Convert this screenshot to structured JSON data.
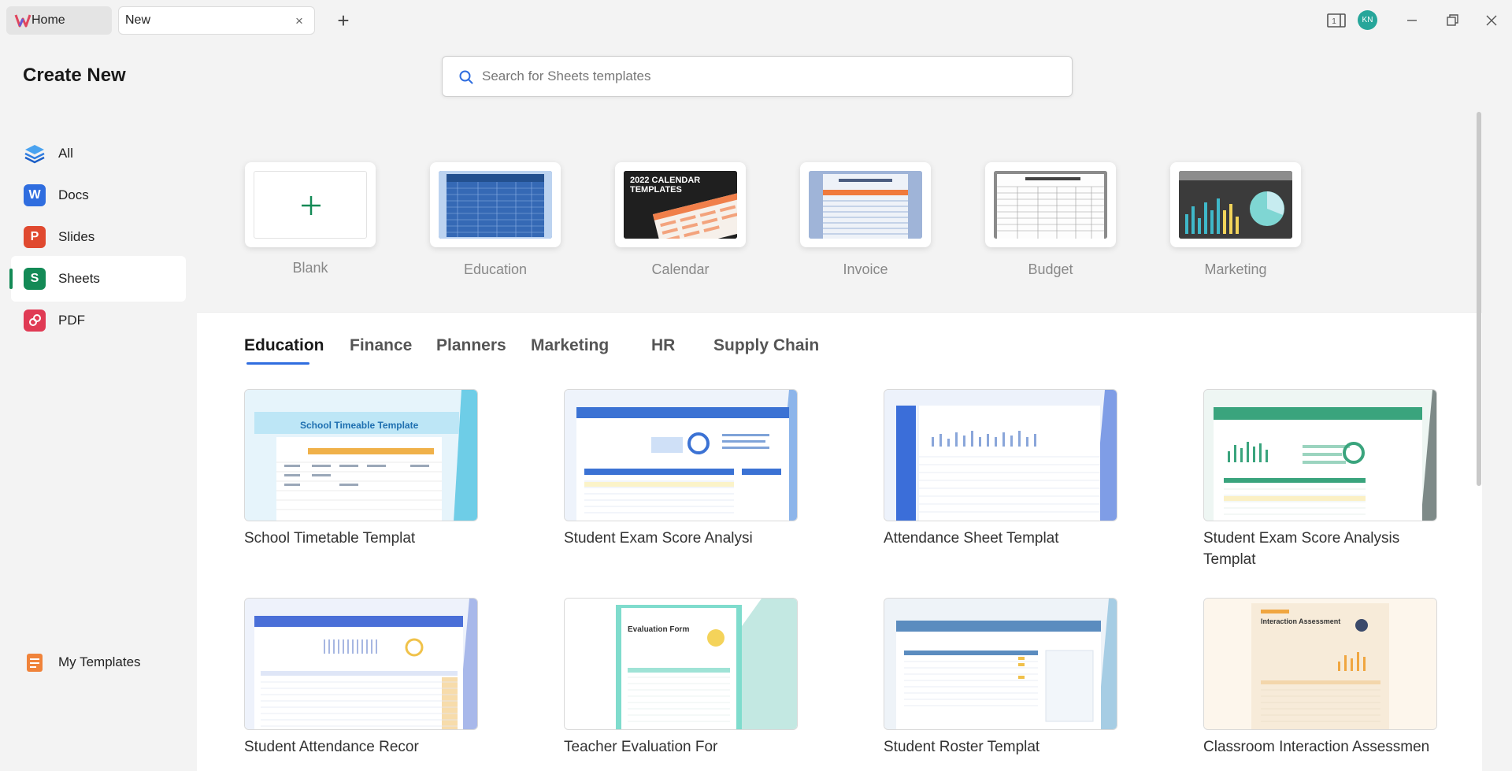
{
  "titlebar": {
    "home_tab": "Home",
    "new_tab": "New",
    "close_glyph": "×",
    "add_glyph": "+",
    "avatar_initials": "KN",
    "page_indicator": "1"
  },
  "sidebar": {
    "title": "Create New",
    "items": [
      {
        "label": "All",
        "icon": "layers-icon",
        "color": "#2f7de1"
      },
      {
        "label": "Docs",
        "icon": "docs-icon",
        "glyph": "W",
        "color": "#2f6ddf"
      },
      {
        "label": "Slides",
        "icon": "slides-icon",
        "glyph": "P",
        "color": "#e0492f"
      },
      {
        "label": "Sheets",
        "icon": "sheets-icon",
        "glyph": "S",
        "color": "#138a56"
      },
      {
        "label": "PDF",
        "icon": "pdf-icon",
        "color": "#e03a54"
      }
    ],
    "my_templates": "My Templates"
  },
  "search": {
    "placeholder": "Search for Sheets templates"
  },
  "categories": [
    {
      "label": "Blank"
    },
    {
      "label": "Education"
    },
    {
      "label": "Calendar",
      "thumb_text": "2022 CALENDAR TEMPLATES"
    },
    {
      "label": "Invoice"
    },
    {
      "label": "Budget"
    },
    {
      "label": "Marketing"
    }
  ],
  "tabs": [
    "Education",
    "Finance",
    "Planners",
    "Marketing",
    "HR",
    "Supply Chain"
  ],
  "active_tab": "Education",
  "templates": [
    {
      "title": "School Timetable Templat",
      "thumb_text": "School Timeable Template"
    },
    {
      "title": "Student Exam Score Analysi"
    },
    {
      "title": "Attendance Sheet Templat"
    },
    {
      "title": "Student Exam Score Analysis Templat"
    },
    {
      "title": "Student Attendance Recor"
    },
    {
      "title": "Teacher Evaluation For",
      "thumb_text": "Evaluation Form"
    },
    {
      "title": "Student Roster Templat"
    },
    {
      "title": "Classroom Interaction Assessmen",
      "thumb_text": "Interaction Assessment"
    }
  ],
  "colors": {
    "accent": "#2f6ddf",
    "sheets_green": "#138a56",
    "avatar": "#26a69a"
  }
}
